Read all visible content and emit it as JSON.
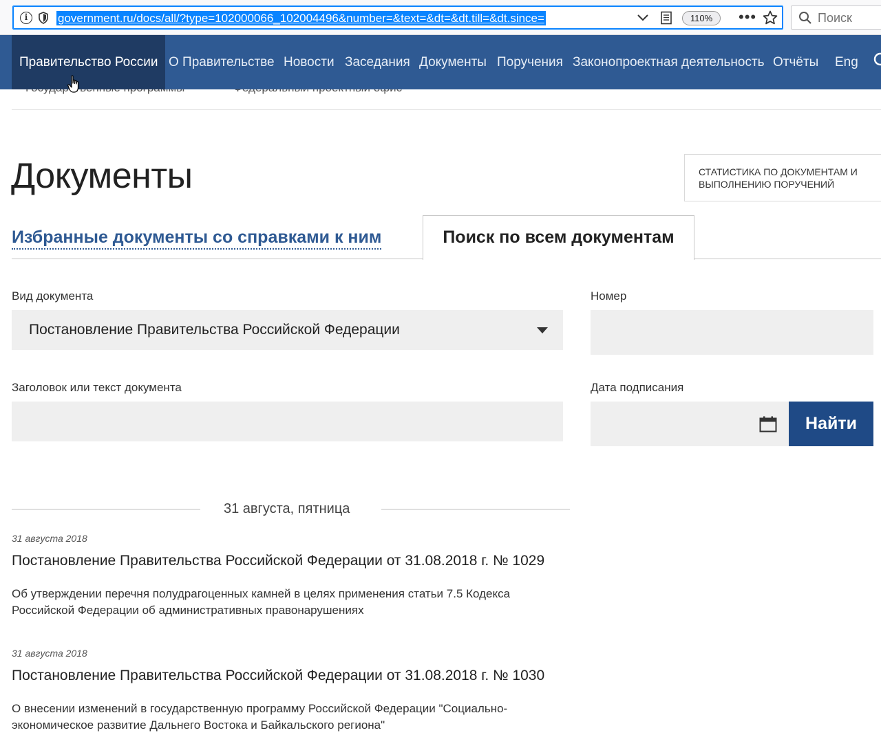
{
  "browser": {
    "url": "government.ru/docs/all/?type=102000066_102004496&number=&text=&dt=&dt.till=&dt.since=",
    "zoom": "110%",
    "search_placeholder": "Поиск",
    "info_glyph": "i",
    "more_glyph": "•••"
  },
  "nav": {
    "items": [
      {
        "label": "Правительство России"
      },
      {
        "label": "О Правительстве"
      },
      {
        "label": "Новости"
      },
      {
        "label": "Заседания"
      },
      {
        "label": "Документы"
      },
      {
        "label": "Поручения"
      },
      {
        "label": "Законопроектная деятельность"
      },
      {
        "label": "Отчёты"
      },
      {
        "label": "Eng"
      }
    ],
    "sub_items": [
      "Государственные программы",
      "Федеральный проектный офис"
    ],
    "colors": {
      "background": "#2f5a93",
      "active": "#1f3b63"
    }
  },
  "page": {
    "title": "Документы",
    "stats_link": "Статистика по документам и выполнению поручений"
  },
  "tabs": {
    "favorites": "Избранные документы со справками к ним",
    "all": "Поиск по всем документам"
  },
  "form": {
    "type_label": "Вид документа",
    "type_value": "Постановление Правительства Российской Федерации",
    "number_label": "Номер",
    "number_value": "",
    "text_label": "Заголовок или текст документа",
    "text_value": "",
    "date_label": "Дата подписания",
    "date_value": "",
    "submit": "Найти"
  },
  "results": {
    "day_heading": "31 августа, пятница",
    "documents": [
      {
        "date": "31 августа 2018",
        "title": "Постановление Правительства Российской Федерации от 31.08.2018 г. № 1029",
        "description": "Об утверждении перечня полудрагоценных камней в целях применения статьи 7.5 Кодекса Российской Федерации об административных правонарушениях"
      },
      {
        "date": "31 августа 2018",
        "title": "Постановление Правительства Российской Федерации от 31.08.2018 г. № 1030",
        "description": "О внесении изменений в государственную программу Российской Федерации \"Социально-экономическое развитие Дальнего Востока и Байкальского региона\""
      }
    ]
  }
}
